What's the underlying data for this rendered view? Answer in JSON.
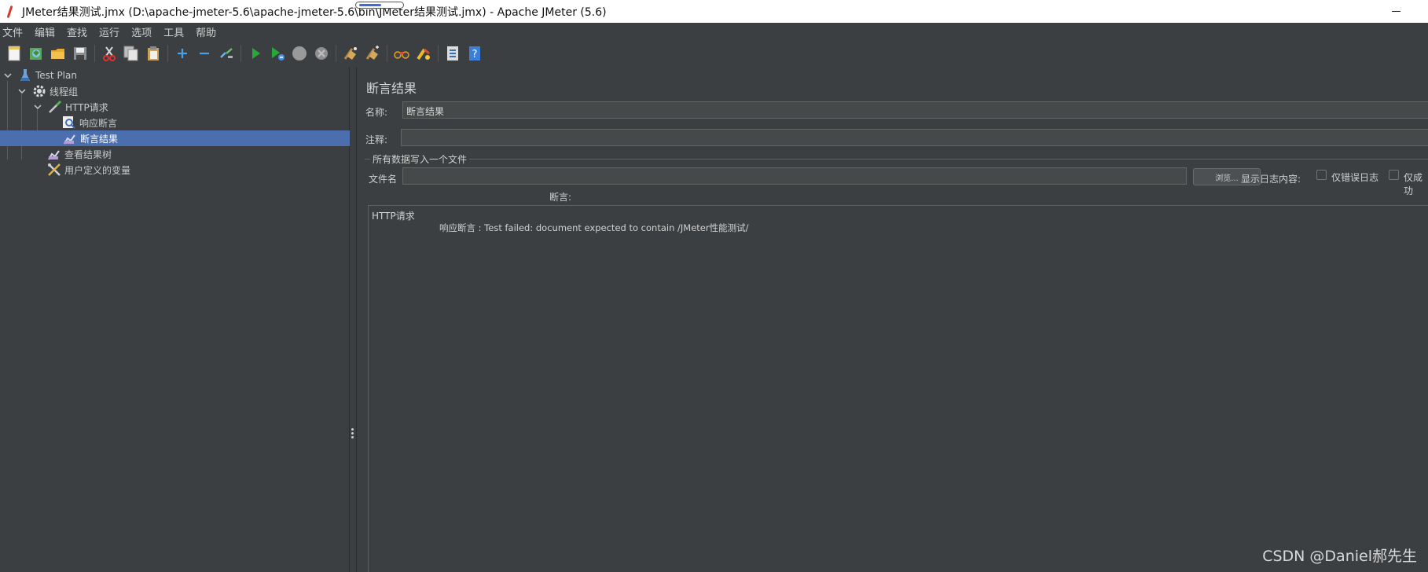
{
  "window": {
    "title": "JMeter结果测试.jmx (D:\\apache-jmeter-5.6\\apache-jmeter-5.6\\bin\\JMeter结果测试.jmx) - Apache JMeter (5.6)"
  },
  "menu": {
    "items": [
      "文件",
      "编辑",
      "查找",
      "运行",
      "选项",
      "工具",
      "帮助"
    ]
  },
  "toolbar": {
    "buttons": [
      "new-icon",
      "templates-icon",
      "open-icon",
      "save-icon",
      "cut-icon",
      "copy-icon",
      "paste-icon",
      "add-icon",
      "remove-icon",
      "toggle-icon",
      "start-icon",
      "start-no-pause-icon",
      "stop-icon",
      "shutdown-icon",
      "clear-icon",
      "clear-all-icon",
      "search-icon",
      "reset-search-icon",
      "function-helper-icon",
      "help-icon"
    ]
  },
  "tree": {
    "items": [
      {
        "label": "Test Plan",
        "icon": "flask-icon",
        "level": 0
      },
      {
        "label": "线程组",
        "icon": "gear-icon",
        "level": 1
      },
      {
        "label": "HTTP请求",
        "icon": "pipette-icon",
        "level": 2
      },
      {
        "label": "响应断言",
        "icon": "assertion-icon",
        "level": 3
      },
      {
        "label": "断言结果",
        "icon": "chart-listener-icon",
        "level": 3,
        "selected": true
      },
      {
        "label": "查看结果树",
        "icon": "chart-listener-icon",
        "level": 2
      },
      {
        "label": "用户定义的变量",
        "icon": "tools-icon",
        "level": 2
      }
    ]
  },
  "panel": {
    "title": "断言结果",
    "name_label": "名称:",
    "name_value": "断言结果",
    "comment_label": "注释:",
    "comment_value": "",
    "file_group_title": "所有数据写入一个文件",
    "filename_label": "文件名",
    "filename_value": "",
    "browse_label": "浏览...",
    "log_display_label": "显示日志内容:",
    "errors_only_label": "仅错误日志",
    "success_only_label": "仅成功",
    "assertions_label": "断言:",
    "result_sampler": "HTTP请求",
    "result_message": "响应断言 : Test failed: document expected to contain /JMeter性能测试/"
  },
  "watermark": "CSDN @Daniel郝先生"
}
